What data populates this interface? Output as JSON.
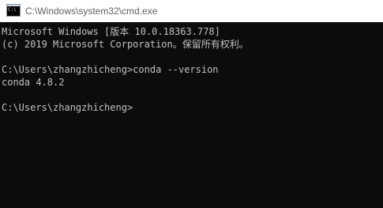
{
  "window": {
    "title": "C:\\Windows\\system32\\cmd.exe",
    "icon": "cmd-prompt-icon",
    "icon_text": "C:\\"
  },
  "console": {
    "background_color": "#0c0c0c",
    "text_color": "#c0c0c0",
    "lines": [
      "Microsoft Windows [版本 10.0.18363.778]",
      "(c) 2019 Microsoft Corporation。保留所有权利。",
      "",
      "C:\\Users\\zhangzhicheng>conda --version",
      "conda 4.8.2",
      "",
      "C:\\Users\\zhangzhicheng>"
    ]
  }
}
